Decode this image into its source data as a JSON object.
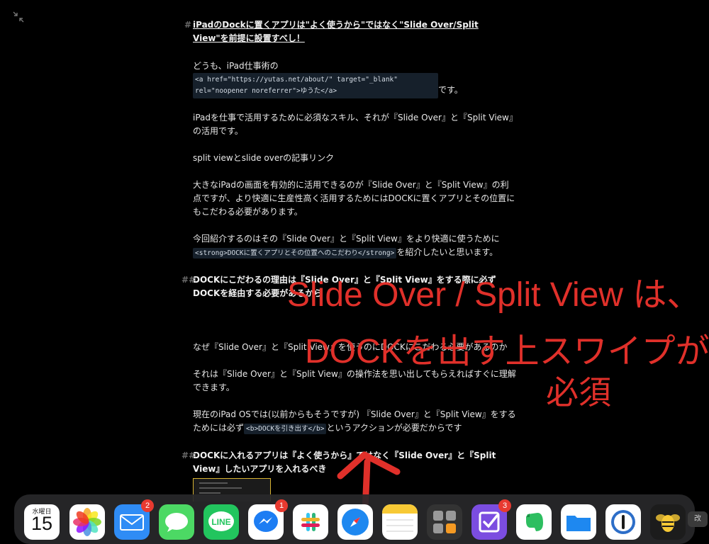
{
  "window": {
    "collapse_icon": "collapse-arrows-icon"
  },
  "article": {
    "h1_mark": "#",
    "h1": "iPadのDockに置くアプリは\"よく使うから\"ではなく\"Slide Over/Split View\"を前提に設置すべし！",
    "p1_pre": "どうも、iPad仕事術の",
    "p1_code": "<a href=\"https://yutas.net/about/\" target=\"_blank\" rel=\"noopener noreferrer\">ゆうた</a>",
    "p1_post": "です。",
    "p2": "iPadを仕事で活用するために必須なスキル、それが『Slide Over』と『Split View』の活用です。",
    "p3": "split viewとslide overの記事リンク",
    "p4": "大きなiPadの画面を有効的に活用できるのが『Slide Over』と『Split View』の利点ですが、より快適に生産性高く活用するためにはDOCKに置くアプリとその位置にもこだわる必要があります。",
    "p5_pre": "今回紹介するのはその『Slide Over』と『Split View』をより快適に使うために",
    "p5_code": "<strong>DOCKに置くアプリとその位置へのこだわり</strong>",
    "p5_post": "を紹介したいと思います。",
    "h2_mark": "##",
    "h2a": "DOCKにこだわるの理由は『Slide Over』と『Split View』をする際に必ずDOCKを経由する必要があるから",
    "p6": "なぜ『Slide Over』と『Split View』を使うのにDOCKにこだわる必要があるのか",
    "p7": "それは『Slide Over』と『Split View』の操作法を思い出してもらえればすぐに理解できます。",
    "p8_pre": "現在のiPad OSでは(以前からもそうですが) 『Slide Over』と『Split View』をするためには必ず",
    "p8_code": "<b>DOCKを引き出す</b>",
    "p8_post": "というアクションが必要だからです",
    "h2b": "DOCKに入れるアプリは『よく使うから』ではなく『Slide Over』と『Split View』したいアプリを入れるべき"
  },
  "annotation": {
    "line1": "Slide Over / Split View は、",
    "line2": "DOCKを出す上スワイプが",
    "line3": "必須",
    "color": "#e0302a"
  },
  "dock": {
    "calendar": {
      "weekday": "水曜日",
      "date": "15"
    },
    "apps": [
      {
        "name": "calendar-app-icon"
      },
      {
        "name": "photos-app-icon"
      },
      {
        "name": "mail-app-icon",
        "badge": "2"
      },
      {
        "name": "messages-app-icon"
      },
      {
        "name": "line-app-icon",
        "label": "LINE"
      },
      {
        "name": "messenger-app-icon",
        "badge": "1"
      },
      {
        "name": "slack-app-icon"
      },
      {
        "name": "safari-app-icon"
      },
      {
        "name": "notes-app-icon"
      },
      {
        "name": "calculator-app-icon"
      },
      {
        "name": "omnifocus-app-icon",
        "badge": "3"
      },
      {
        "name": "evernote-app-icon"
      },
      {
        "name": "files-app-icon"
      },
      {
        "name": "1password-app-icon"
      },
      {
        "name": "tes-app-icon"
      }
    ],
    "keyboard_hint": "改"
  }
}
